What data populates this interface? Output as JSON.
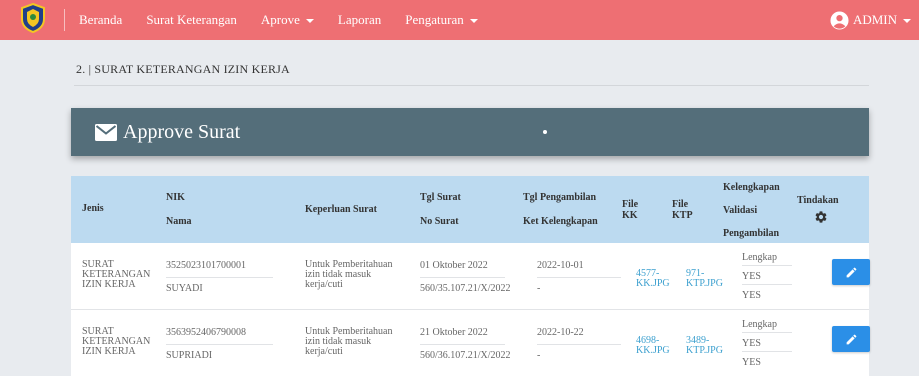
{
  "navbar": {
    "items": [
      {
        "label": "Beranda",
        "dropdown": false
      },
      {
        "label": "Surat Keterangan",
        "dropdown": false
      },
      {
        "label": "Aprove",
        "dropdown": true
      },
      {
        "label": "Laporan",
        "dropdown": false
      },
      {
        "label": "Pengaturan",
        "dropdown": true
      }
    ],
    "user_label": "ADMIN",
    "color": "#ee6f73"
  },
  "breadcrumb": "2. | SURAT KETERANGAN IZIN KERJA",
  "banner": {
    "title": "Approve Surat",
    "icon": "envelope-icon",
    "color": "#546e7a"
  },
  "table": {
    "headers": {
      "jenis": "Jenis",
      "nik": "NIK",
      "nama": "Nama",
      "keperluan": "Keperluan Surat",
      "tgl_surat": "Tgl Surat",
      "no_surat": "No Surat",
      "tgl_pengambilan": "Tgl Pengambilan",
      "ket_kelengkapan": "Ket Kelengkapan",
      "file_kk": "File KK",
      "file_ktp": "File KTP",
      "kelengkapan": "Kelengkapan",
      "validasi": "Validasi",
      "pengambilan": "Pengambilan",
      "tindakan": "Tindakan"
    },
    "rows": [
      {
        "jenis": "SURAT KETERANGAN IZIN KERJA",
        "nik": "3525023101700001",
        "nama": "SUYADI",
        "keperluan": "Untuk Pemberitahuan izin tidak masuk kerja/cuti",
        "tgl_surat": "01 Oktober 2022",
        "no_surat": "560/35.107.21/X/2022",
        "tgl_pengambilan": "2022-10-01",
        "ket_kelengkapan": "-",
        "file_kk": "4577-KK.JPG",
        "file_ktp": "971-KTP.JPG",
        "kelengkapan": "Lengkap",
        "validasi": "YES",
        "pengambilan": "YES"
      },
      {
        "jenis": "SURAT KETERANGAN IZIN KERJA",
        "nik": "3563952406790008",
        "nama": "SUPRIADI",
        "keperluan": "Untuk Pemberitahuan izin tidak masuk kerja/cuti",
        "tgl_surat": "21 Oktober 2022",
        "no_surat": "560/36.107.21/X/2022",
        "tgl_pengambilan": "2022-10-22",
        "ket_kelengkapan": "-",
        "file_kk": "4698-KK.JPG",
        "file_ktp": "3489-KTP.JPG",
        "kelengkapan": "Lengkap",
        "validasi": "YES",
        "pengambilan": "YES"
      }
    ],
    "header_color": "#bcdaf0",
    "button_color": "#2b8fe7",
    "link_color": "#3ca0cf"
  }
}
